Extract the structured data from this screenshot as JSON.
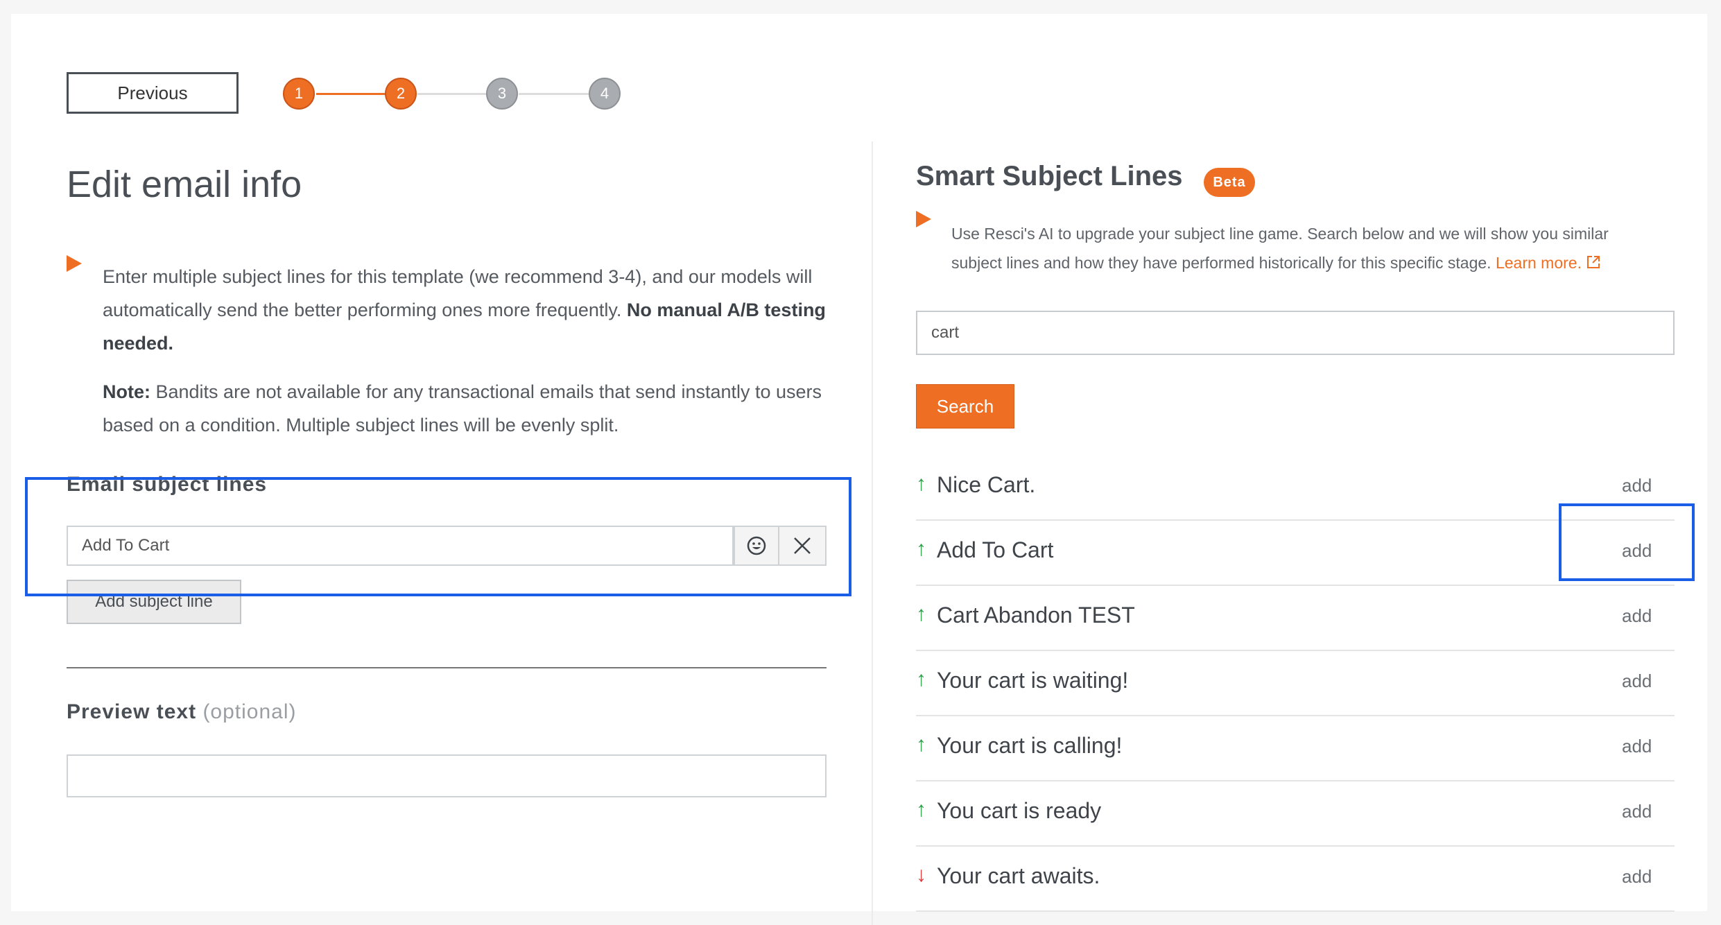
{
  "nav": {
    "previous_label": "Previous",
    "steps": [
      {
        "label": "1",
        "state": "active"
      },
      {
        "label": "2",
        "state": "active"
      },
      {
        "label": "3",
        "state": "inactive"
      },
      {
        "label": "4",
        "state": "inactive"
      }
    ]
  },
  "left": {
    "title": "Edit email info",
    "intro_text": "Enter multiple subject lines for this template (we recommend 3-4), and our models will automatically send the better performing ones more frequently. ",
    "intro_bold": "No manual A/B testing needed.",
    "note_bold": "Note:",
    "note_text": " Bandits are not available for any transactional emails that send instantly to users based on a condition. Multiple subject lines will be evenly split.",
    "subject_section_label": "Email subject lines",
    "subject_value": "Add To Cart",
    "emoji_icon": "smiley-icon",
    "remove_icon": "close-icon",
    "add_subject_label": "Add subject line",
    "preview_label": "Preview text",
    "preview_optional": "(optional)",
    "preview_value": ""
  },
  "right": {
    "title": "Smart Subject Lines",
    "badge": "Beta",
    "description": "Use Resci's AI to upgrade your subject line game. Search below and we will show you similar subject lines and how they have performed historically for this specific stage.",
    "learn_more": "Learn more.",
    "search_value": "cart",
    "search_label": "Search",
    "results": [
      {
        "label": "Nice Cart.",
        "trend": "up",
        "arrow": "↑",
        "add": "add"
      },
      {
        "label": "Add To Cart",
        "trend": "up",
        "arrow": "↑",
        "add": "add"
      },
      {
        "label": "Cart Abandon TEST",
        "trend": "up",
        "arrow": "↑",
        "add": "add"
      },
      {
        "label": "Your cart is waiting!",
        "trend": "up",
        "arrow": "↑",
        "add": "add"
      },
      {
        "label": "Your cart is calling!",
        "trend": "up",
        "arrow": "↑",
        "add": "add"
      },
      {
        "label": "You cart is ready",
        "trend": "up",
        "arrow": "↑",
        "add": "add"
      },
      {
        "label": "Your cart awaits.",
        "trend": "down",
        "arrow": "↓",
        "add": "add"
      }
    ]
  },
  "colors": {
    "accent": "#ee6f23",
    "highlight": "#1a5ee8",
    "trend_up": "#2e9e48",
    "trend_down": "#e03a3a"
  }
}
